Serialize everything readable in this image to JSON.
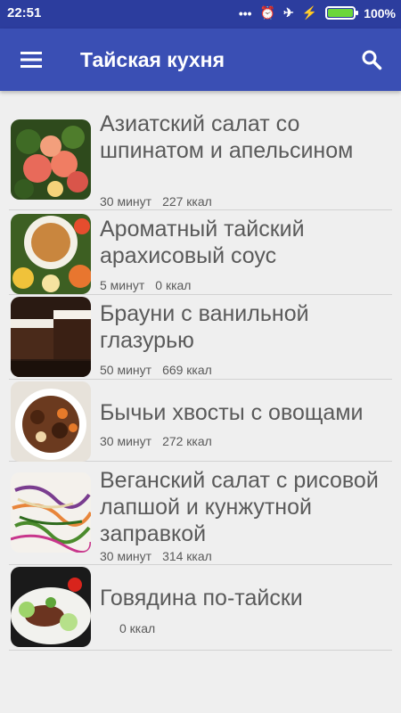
{
  "statusbar": {
    "time": "22:51",
    "battery": "100%"
  },
  "toolbar": {
    "title": "Тайская кухня"
  },
  "recipes": [
    {
      "title": "Азиатский салат со шпинатом и апельсином",
      "time": "30 минут",
      "kcal": "227 ккал"
    },
    {
      "title": "Ароматный тайский арахисовый соус",
      "time": "5 минут",
      "kcal": "0 ккал"
    },
    {
      "title": "Брауни с ванильной глазурью",
      "time": "50 минут",
      "kcal": "669 ккал"
    },
    {
      "title": "Бычьи хвосты с овощами",
      "time": "30 минут",
      "kcal": "272 ккал"
    },
    {
      "title": "Веганский салат с рисовой лапшой и кунжутной заправкой",
      "time": "30 минут",
      "kcal": "314 ккал"
    },
    {
      "title": "Говядина по-тайски",
      "time": "",
      "kcal": "0 ккал"
    }
  ],
  "icons": {
    "menu": "menu-icon",
    "search": "search-icon"
  },
  "colors": {
    "primary": "#3a4fb4",
    "status": "#2c3d9e"
  }
}
